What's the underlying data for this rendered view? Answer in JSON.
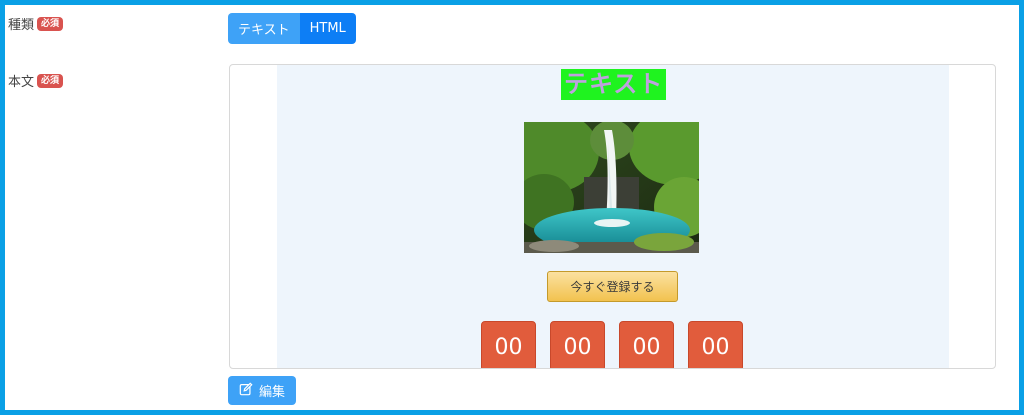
{
  "form": {
    "type_field": {
      "label": "種類",
      "required_badge": "必須",
      "options": [
        "テキスト",
        "HTML"
      ],
      "selected": "HTML"
    },
    "body_field": {
      "label": "本文",
      "required_badge": "必須"
    }
  },
  "preview": {
    "heading": "テキスト",
    "image_alt": "waterfall",
    "cta_label": "今すぐ登録する",
    "countdown": [
      "00",
      "00",
      "00",
      "00"
    ]
  },
  "actions": {
    "edit_label": "編集",
    "edit_icon": "pencil-square-icon"
  },
  "colors": {
    "frame_border": "#0aa0e6",
    "badge": "#d9534f",
    "toggle_active": "#0d7ef5",
    "toggle_inactive": "#3ea2f7",
    "heading_bg": "#1ff31f",
    "heading_text": "#bfa0df",
    "counter_bg": "#e15c3c"
  }
}
